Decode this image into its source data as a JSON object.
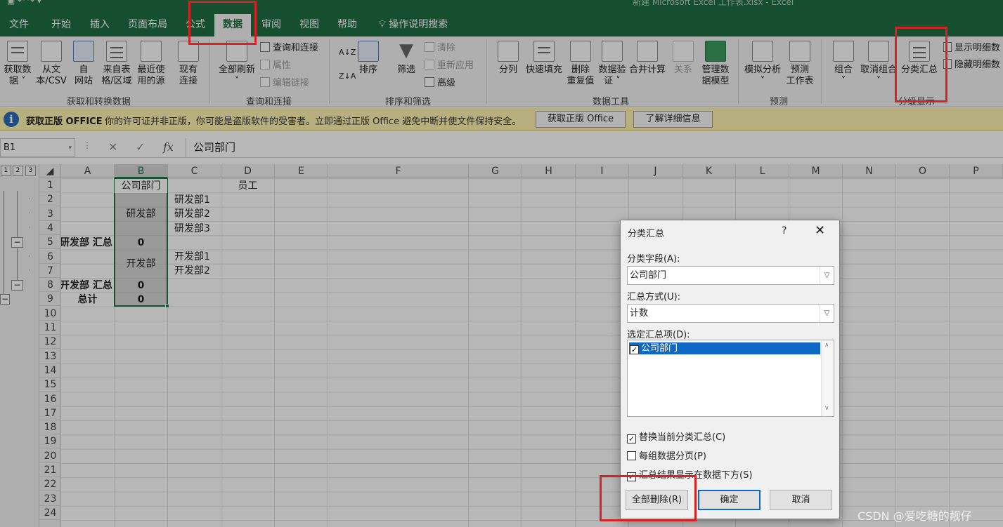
{
  "window": {
    "title": "新建 Microsoft Excel 工作表.xlsx - Excel"
  },
  "tabs": [
    {
      "label": "文件"
    },
    {
      "label": "开始"
    },
    {
      "label": "插入"
    },
    {
      "label": "页面布局"
    },
    {
      "label": "公式"
    },
    {
      "label": "数据"
    },
    {
      "label": "审阅"
    },
    {
      "label": "视图"
    },
    {
      "label": "帮助"
    },
    {
      "label": "操作说明搜索"
    }
  ],
  "ribbon": {
    "get_data": {
      "l1": "获取数",
      "l2": "据 ˅"
    },
    "from_csv": {
      "l1": "从文",
      "l2": "本/CSV"
    },
    "from_web": {
      "l1": "自",
      "l2": "网站"
    },
    "from_table": {
      "l1": "来自表",
      "l2": "格/区域"
    },
    "recent": {
      "l1": "最近使",
      "l2": "用的源"
    },
    "existing": {
      "l1": "现有",
      "l2": "连接"
    },
    "group1": "获取和转换数据",
    "refresh_all": {
      "l1": "全部刷新",
      "l2": "˅"
    },
    "query_conn": "查询和连接",
    "properties": "属性",
    "edit_links": "编辑链接",
    "group2": "查询和连接",
    "sort": "排序",
    "filter": "筛选",
    "clear": "清除",
    "reapply": "重新应用",
    "advanced": "高级",
    "group3": "排序和筛选",
    "split": "分列",
    "flash_fill": "快速填充",
    "remove_dup": {
      "l1": "删除",
      "l2": "重复值"
    },
    "validate": {
      "l1": "数据验",
      "l2": "证 ˅"
    },
    "consolidate": "合并计算",
    "relations": "关系",
    "data_model": {
      "l1": "管理数",
      "l2": "据模型"
    },
    "group4": "数据工具",
    "whatif": {
      "l1": "模拟分析",
      "l2": "˅"
    },
    "forecast": {
      "l1": "预测",
      "l2": "工作表"
    },
    "group5": "预测",
    "group_btn": {
      "l1": "组合",
      "l2": "˅"
    },
    "ungroup": {
      "l1": "取消组合",
      "l2": "˅"
    },
    "subtotal": "分类汇总",
    "show_detail": "显示明细数",
    "hide_detail": "隐藏明细数",
    "group6": "分级显示"
  },
  "message_bar": {
    "title": "获取正版 OFFICE",
    "text": "你的许可证并非正版，你可能是盗版软件的受害者。立即通过正版 Office 避免中断并使文件保持安全。",
    "btn_get": "获取正版 Office",
    "btn_learn": "了解详细信息"
  },
  "formula_bar": {
    "name_box": "B1",
    "fx": "fx",
    "value": "公司部门"
  },
  "grid": {
    "outline_levels": [
      "1",
      "2",
      "3"
    ],
    "columns": [
      "A",
      "B",
      "C",
      "D",
      "E",
      "F",
      "G",
      "H",
      "I",
      "J",
      "K",
      "L",
      "M",
      "N",
      "O",
      "P"
    ],
    "rows": [
      "1",
      "2",
      "3",
      "4",
      "5",
      "6",
      "7",
      "8",
      "9",
      "10",
      "11",
      "12",
      "13",
      "14",
      "15",
      "16",
      "17",
      "18",
      "19",
      "20",
      "21",
      "22",
      "23",
      "24"
    ],
    "cells": {
      "b1": "公司部门",
      "c1": "员工",
      "b_rd": "研发部",
      "c2": "研发部1",
      "c3": "研发部2",
      "c4": "研发部3",
      "a5": "研发部 汇总",
      "b5": "0",
      "b_dev": "开发部",
      "c6": "开发部1",
      "c7": "开发部2",
      "a8": "开发部 汇总",
      "b8": "0",
      "a9": "总计",
      "b9": "0"
    }
  },
  "dialog": {
    "title": "分类汇总",
    "help": "?",
    "close": "✕",
    "field_label": "分类字段(A):",
    "field_value": "公司部门",
    "func_label": "汇总方式(U):",
    "func_value": "计数",
    "items_label": "选定汇总项(D):",
    "items": [
      "公司部门"
    ],
    "opt_replace": "替换当前分类汇总(C)",
    "opt_pagebreak": "每组数据分页(P)",
    "opt_below": "汇总结果显示在数据下方(S)",
    "btn_remove_all": "全部删除(R)",
    "btn_ok": "确定",
    "btn_cancel": "取消"
  },
  "watermark": "CSDN @爱吃糖的靓仔",
  "colors": {
    "excel_green": "#1e6e42",
    "annotation_red": "#d62222",
    "selection_blue": "#0f67c6"
  }
}
